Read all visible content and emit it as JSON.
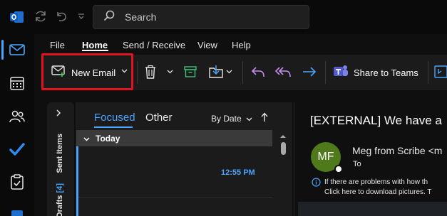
{
  "titlebar": {
    "search_placeholder": "Search"
  },
  "menu": {
    "tabs": [
      "File",
      "Home",
      "Send / Receive",
      "View",
      "Help"
    ],
    "active": "Home"
  },
  "ribbon": {
    "new_email_label": "New Email",
    "share_to_teams_label": "Share to Teams"
  },
  "folders": {
    "sent_items": "Sent Items",
    "drafts": "Drafts",
    "drafts_count": "[4]"
  },
  "message_list": {
    "tab_focused": "Focused",
    "tab_other": "Other",
    "sort_label": "By Date",
    "group_label": "Today",
    "messages": [
      {
        "time": "12:55 PM"
      }
    ]
  },
  "reading_pane": {
    "subject": "[EXTERNAL] We have a",
    "avatar_initials": "MF",
    "sender": "Meg from Scribe <m",
    "to_label": "To",
    "info_line1": "If there are problems with how th",
    "info_line2": "Click here to download pictures. T"
  },
  "colors": {
    "accent": "#4aa3ff",
    "highlight_box": "#e0141e",
    "avatar_bg": "#4e7a1c",
    "reply_icons": "#c58ef0"
  }
}
